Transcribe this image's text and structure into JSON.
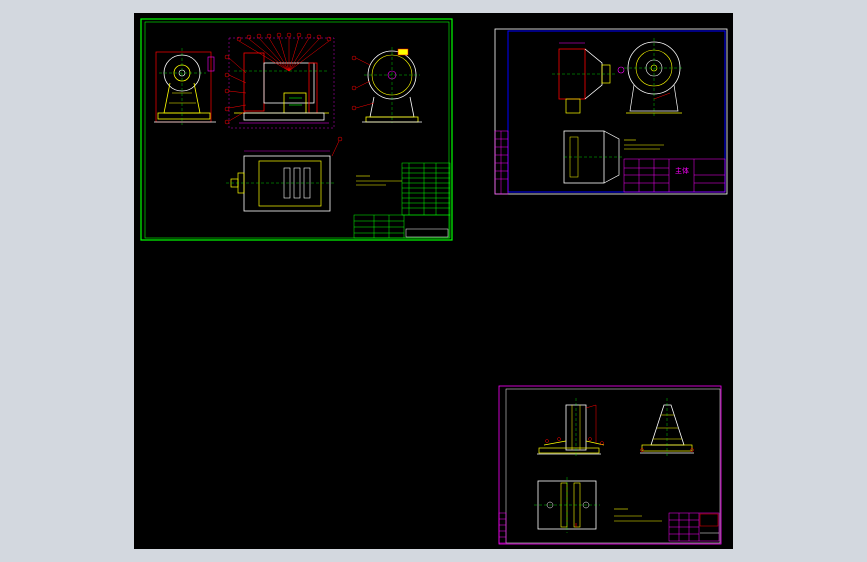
{
  "app": {
    "viewport_background": "#d3d8df",
    "canvas_background": "#000000"
  },
  "sheets": [
    {
      "id": "assembly",
      "border_color": "#00ff00",
      "notes_color": "#ffff00",
      "table_color": "#00ff00"
    },
    {
      "id": "part-detail",
      "border_color": "#ffffff",
      "inner_border_color": "#0000ff",
      "title_block_text": "主体",
      "title_block_color": "#ff00ff"
    },
    {
      "id": "base-detail",
      "border_color": "#ff00ff",
      "notes_color": "#ffff00"
    }
  ],
  "colors": {
    "geometry": "#ffffff",
    "leaders": "#ff0000",
    "centerlines": "#00ff00",
    "dimensions": "#ff00ff",
    "accent": "#ffff00"
  }
}
